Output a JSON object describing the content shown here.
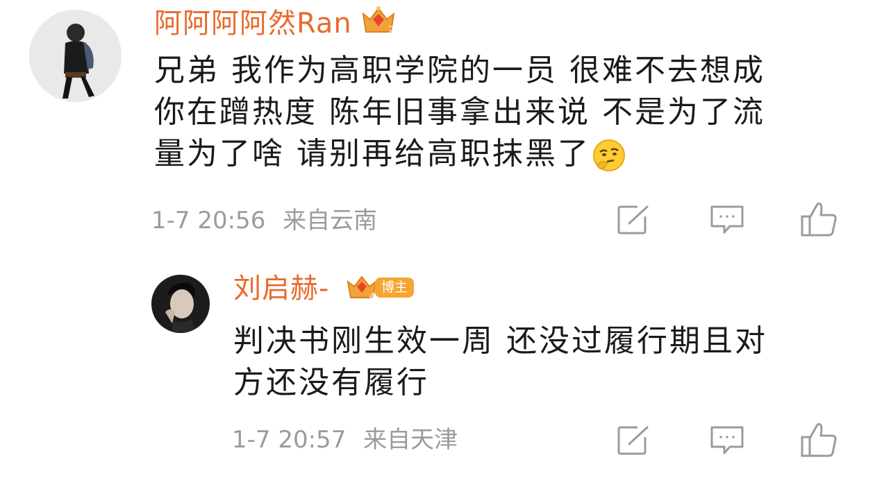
{
  "comments": [
    {
      "username": "阿阿阿阿然Ran",
      "level": "2",
      "text_lines": [
        "兄弟 我作为高职学院的一员 很难不去想成",
        "你在蹭热度 陈年旧事拿出来说 不是为了流",
        "量为了啥 请别再给高职抹黑了"
      ],
      "emoji": "thinking-emoji",
      "time": "1-7 20:56",
      "location": "来自云南",
      "actions": [
        "share-icon",
        "comment-icon",
        "like-icon"
      ]
    },
    {
      "username": "刘启赫-",
      "level": "4",
      "badge": "博主",
      "text_lines": [
        "判决书刚生效一周 还没过履行期且对",
        "方还没有履行"
      ],
      "time": "1-7 20:57",
      "location": "来自天津",
      "actions": [
        "share-icon",
        "comment-icon",
        "like-icon"
      ]
    }
  ],
  "colors": {
    "username": "#e86a2c",
    "meta": "#9b9b9b",
    "text": "#1a1a1a",
    "badge": "#f7a531"
  }
}
